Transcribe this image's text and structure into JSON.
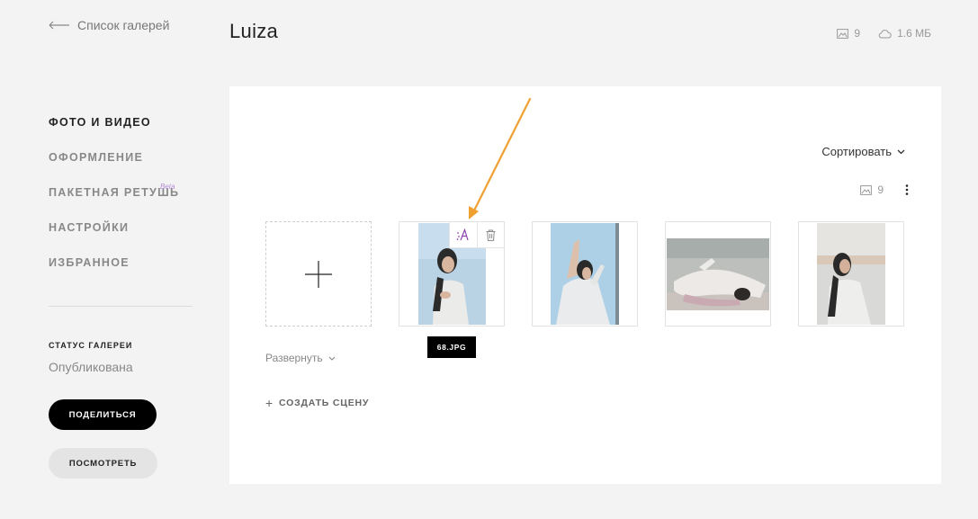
{
  "header": {
    "back_label": "Список галерей",
    "gallery_title": "Luiza",
    "photo_count": "9",
    "storage_size": "1.6 МБ"
  },
  "sidebar": {
    "items": [
      {
        "label": "ФОТО И ВИДЕО",
        "active": true
      },
      {
        "label": "ОФОРМЛЕНИЕ",
        "active": false
      },
      {
        "label": "ПАКЕТНАЯ РЕТУШЬ",
        "active": false,
        "badge": "Beta"
      },
      {
        "label": "НАСТРОЙКИ",
        "active": false
      },
      {
        "label": "ИЗБРАННОЕ",
        "active": false
      }
    ],
    "status_label": "СТАТУС ГАЛЕРЕИ",
    "status_value": "Опубликована",
    "share_label": "ПОДЕЛИТЬСЯ",
    "view_label": "ПОСМОТРЕТЬ"
  },
  "main": {
    "sort_label": "Сортировать",
    "photo_count": "9",
    "tooltip_filename": "68.JPG",
    "expand_label": "Развернуть",
    "create_scene_label": "СОЗДАТЬ СЦЕНУ",
    "photos": [
      {
        "orientation": "portrait",
        "hovered": true
      },
      {
        "orientation": "portrait"
      },
      {
        "orientation": "landscape"
      },
      {
        "orientation": "portrait"
      }
    ]
  },
  "colors": {
    "accent_purple": "#8e44ad",
    "annotation_arrow": "#f0a030",
    "beta_badge": "#b58ed6"
  }
}
